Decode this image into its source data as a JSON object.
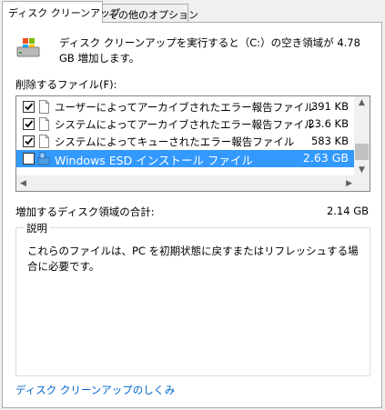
{
  "tabs": [
    {
      "label": "ディスク クリーンアップ",
      "active": true
    },
    {
      "label": "その他のオプション",
      "active": false
    }
  ],
  "header": {
    "icon": "drive-cleanup-icon",
    "description": "ディスク クリーンアップを実行すると（C:）の空き領域が 4.78 GB 増加します。"
  },
  "files": {
    "label": "削除するファイル(F):",
    "items": [
      {
        "label": "ユーザーによってアーカイブされたエラー報告ファイル",
        "size": "391 KB",
        "checked": true,
        "selected": false,
        "icon": "file-icon"
      },
      {
        "label": "システムによってアーカイブされたエラー報告ファイル",
        "size": "23.6 KB",
        "checked": true,
        "selected": false,
        "icon": "file-icon"
      },
      {
        "label": "システムによってキューされたエラー報告ファイル",
        "size": "583 KB",
        "checked": true,
        "selected": false,
        "icon": "file-icon"
      },
      {
        "label": "Windows ESD インストール ファイル",
        "size": "2.63 GB",
        "checked": false,
        "selected": true,
        "icon": "windows-installer-icon"
      }
    ]
  },
  "total": {
    "label": "増加するディスク領域の合計:",
    "value": "2.14 GB"
  },
  "description_box": {
    "title": "説明",
    "text": "これらのファイルは、PC を初期状態に戻すまたはリフレッシュする場合に必要です。"
  },
  "help_link": "ディスク クリーンアップのしくみ",
  "colors": {
    "selection": "#3399ff",
    "link": "#0066cc"
  }
}
